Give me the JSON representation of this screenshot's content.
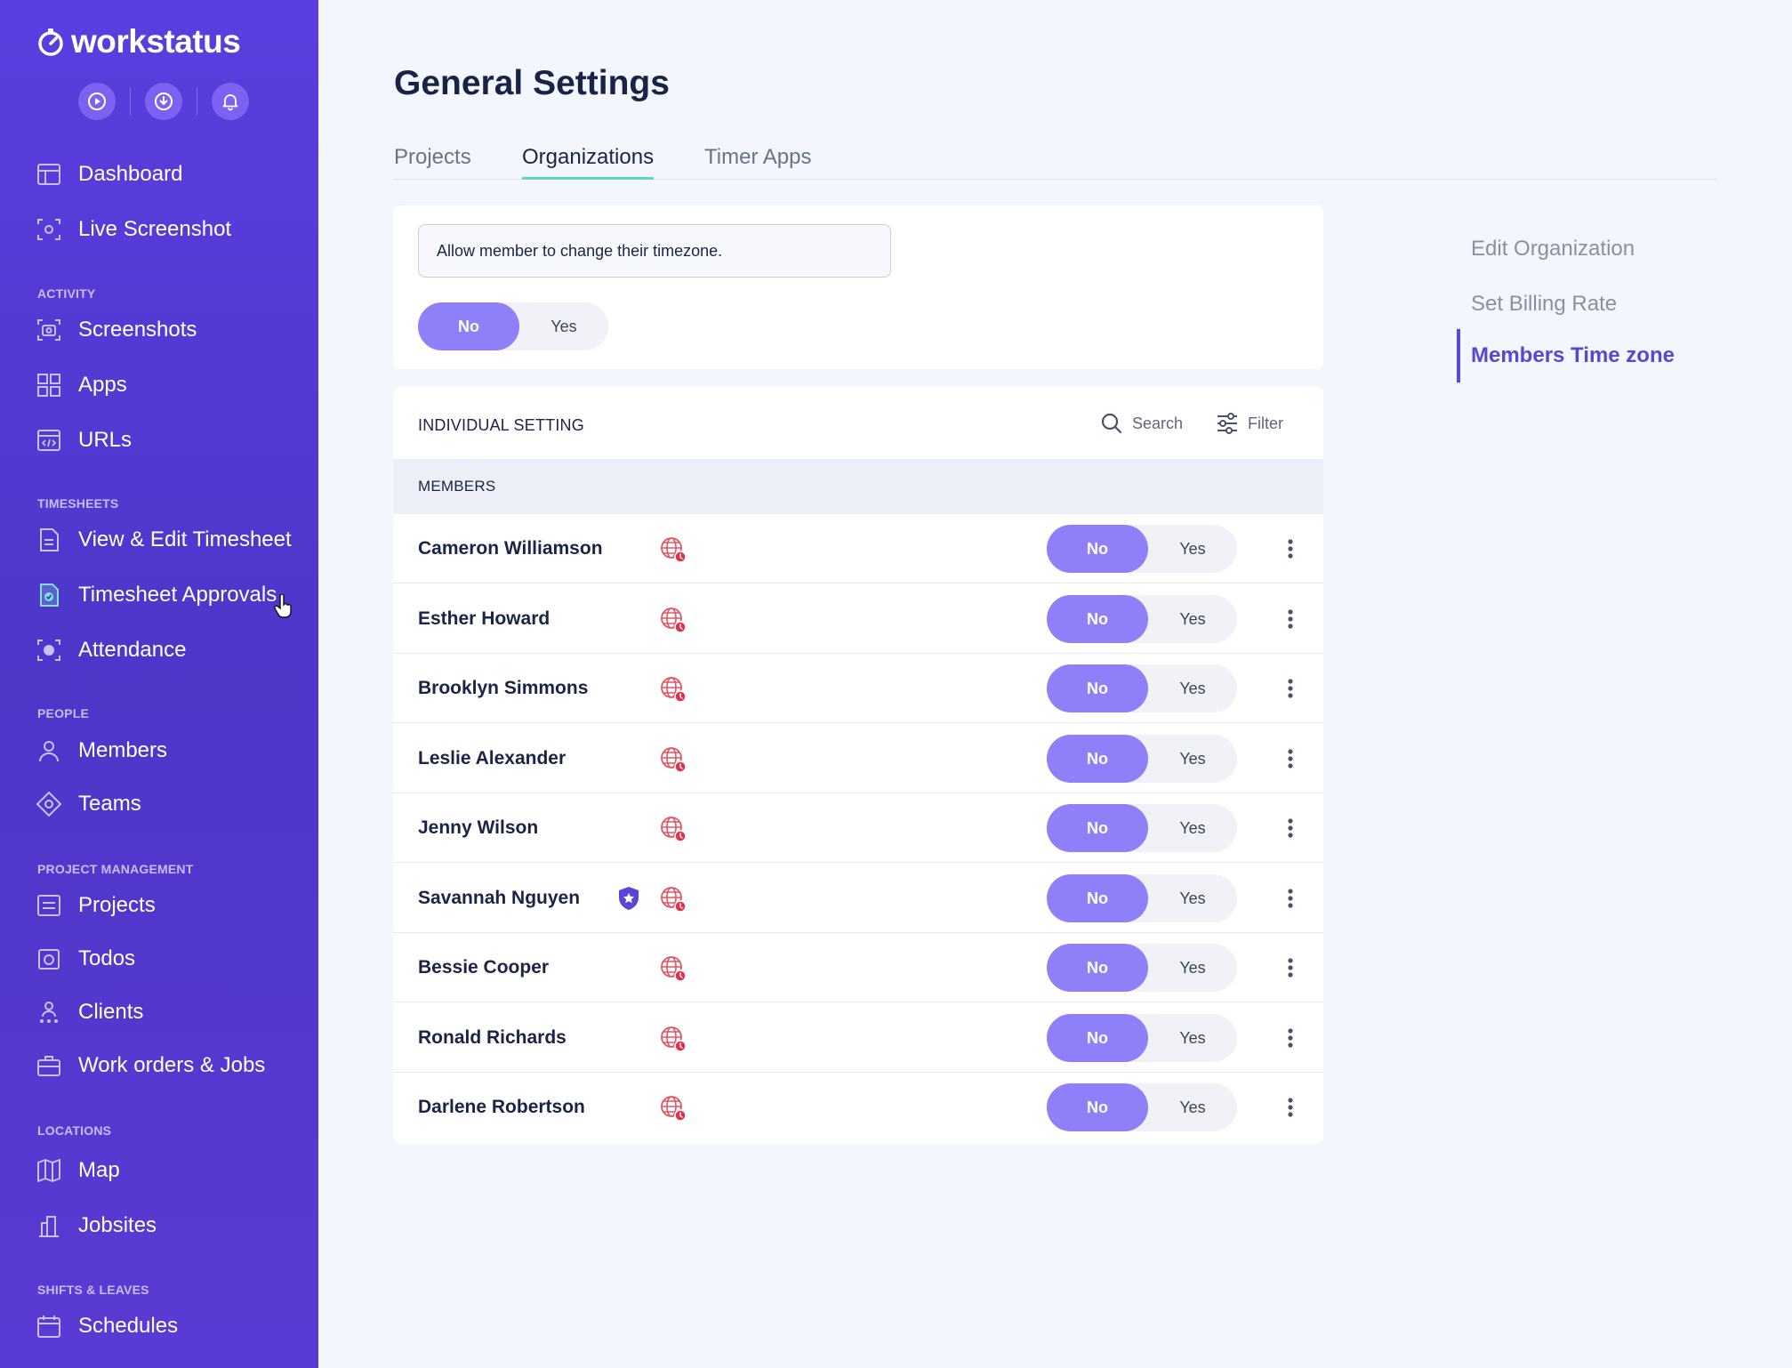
{
  "app": {
    "brand": "workstatus"
  },
  "colors": {
    "sidebar": "#5035d0",
    "accent": "#8f7ff8",
    "tab_underline": "#5cd6c7",
    "active_link": "#5b45d8"
  },
  "sidebar": {
    "quick_actions": [
      {
        "icon": "play-circle-icon"
      },
      {
        "icon": "download-circle-icon"
      },
      {
        "icon": "bell-icon"
      }
    ],
    "items": {
      "dashboard": "Dashboard",
      "live_screenshot": "Live Screenshot",
      "screenshots": "Screenshots",
      "apps": "Apps",
      "urls": "URLs",
      "view_edit_timesheet": "View & Edit Timesheet",
      "timesheet_approvals": "Timesheet Approvals",
      "attendance": "Attendance",
      "members": "Members",
      "teams": "Teams",
      "projects": "Projects",
      "todos": "Todos",
      "clients": "Clients",
      "work_orders": "Work orders & Jobs",
      "map": "Map",
      "jobsites": "Jobsites",
      "schedules": "Schedules"
    },
    "sections": {
      "activity": "ACTIVITY",
      "timesheets": "TIMESHEETS",
      "people": "PEOPLE",
      "project_management": "PROJECT MANAGEMENT",
      "locations": "LOCATIONS",
      "shifts_leaves": "SHIFTS & LEAVES"
    }
  },
  "main": {
    "title": "General Settings",
    "tabs": [
      "Projects",
      "Organizations",
      "Timer Apps"
    ],
    "active_tab": "Organizations",
    "setting": {
      "label": "Allow member to change their timezone.",
      "no": "No",
      "yes": "Yes",
      "selected": "No"
    },
    "individual": {
      "title": "INDIVIDUAL SETTING",
      "search": "Search",
      "filter": "Filter",
      "members_header": "MEMBERS",
      "rows": [
        {
          "name": "Cameron Williamson",
          "no": "No",
          "yes": "Yes",
          "selected": "No"
        },
        {
          "name": "Esther Howard",
          "no": "No",
          "yes": "Yes",
          "selected": "No"
        },
        {
          "name": "Brooklyn Simmons",
          "no": "No",
          "yes": "Yes",
          "selected": "No"
        },
        {
          "name": "Leslie Alexander",
          "no": "No",
          "yes": "Yes",
          "selected": "No"
        },
        {
          "name": "Jenny Wilson",
          "no": "No",
          "yes": "Yes",
          "selected": "No"
        },
        {
          "name": "Savannah Nguyen",
          "no": "No",
          "yes": "Yes",
          "selected": "No",
          "admin_badge": true
        },
        {
          "name": "Bessie Cooper",
          "no": "No",
          "yes": "Yes",
          "selected": "No"
        },
        {
          "name": "Ronald Richards",
          "no": "No",
          "yes": "Yes",
          "selected": "No"
        },
        {
          "name": "Darlene Robertson",
          "no": "No",
          "yes": "Yes",
          "selected": "No"
        }
      ]
    }
  },
  "right_nav": {
    "items": [
      "Edit Organization",
      "Set Billing Rate",
      "Members Time zone"
    ],
    "active": "Members Time zone"
  }
}
